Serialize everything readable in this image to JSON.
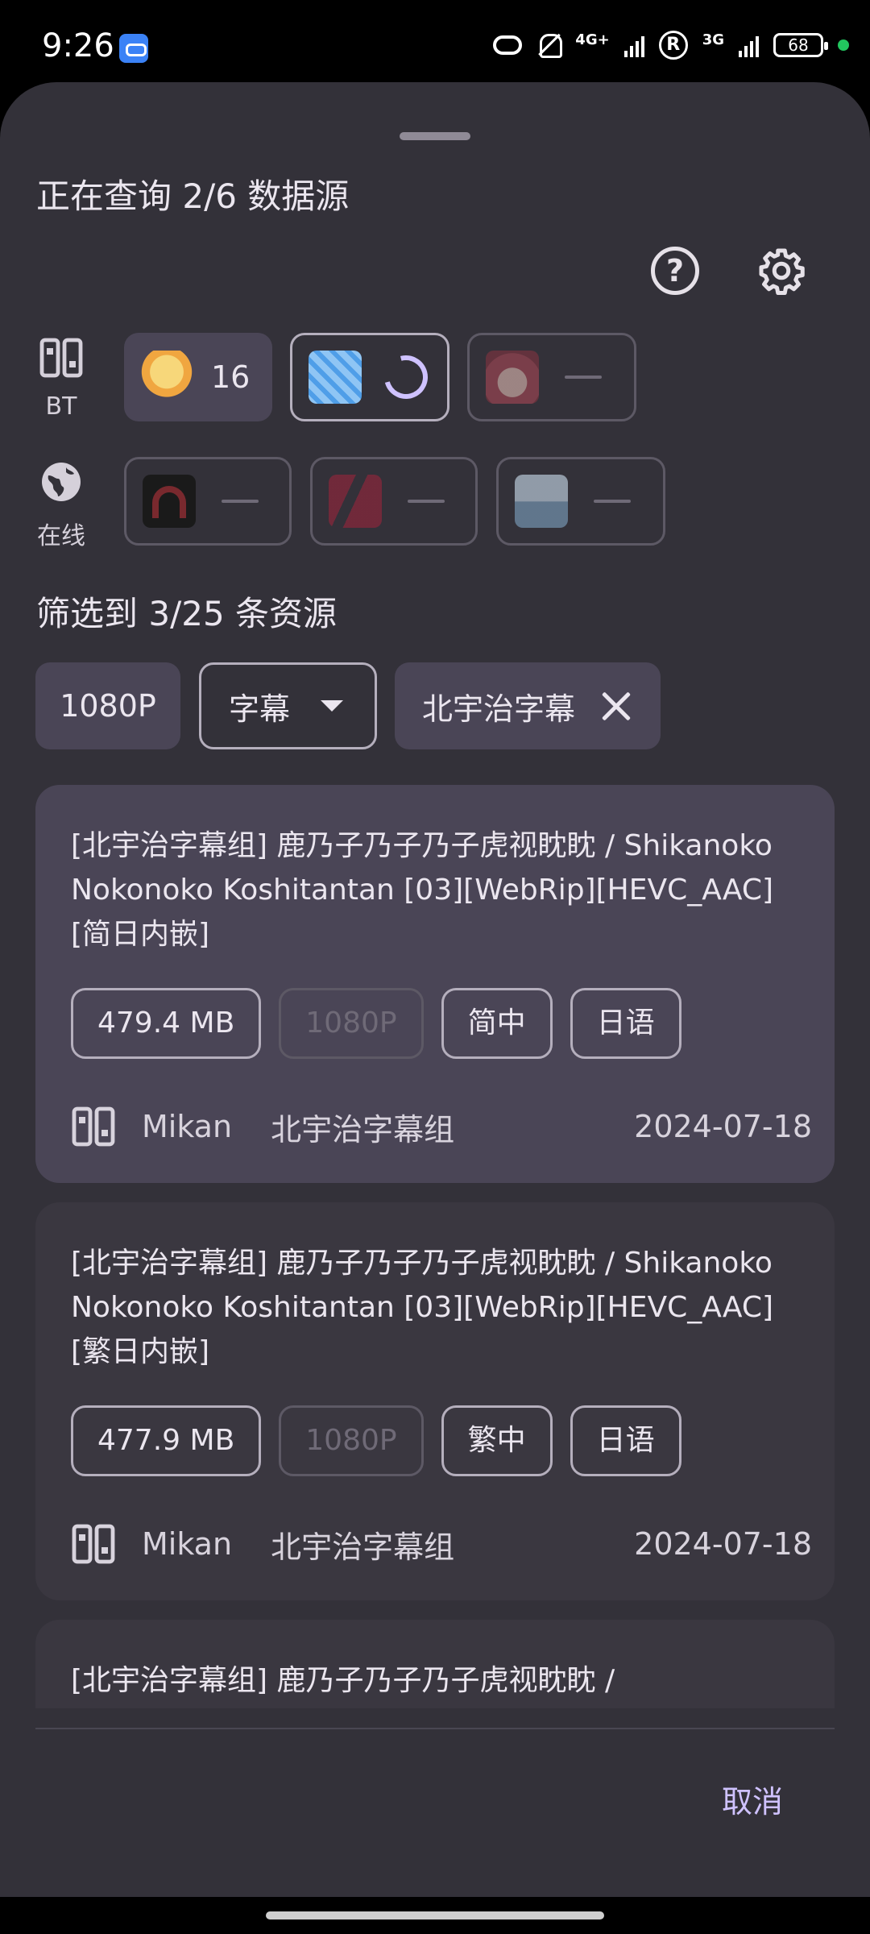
{
  "status_bar": {
    "time": "9:26",
    "network_4g": "4G+",
    "network_3g": "3G",
    "registered": "R",
    "battery": "68",
    "icons": [
      "link-app-icon",
      "hotspot-icon",
      "mute-icon",
      "signal-icon",
      "roaming-icon",
      "battery-icon"
    ]
  },
  "header": {
    "title": "正在查询 2/6 数据源",
    "help_icon": "question-circle",
    "settings_icon": "gear"
  },
  "sources": {
    "bt_label": "BT",
    "online_label": "在线",
    "bt": [
      {
        "state": "done",
        "count": "16"
      },
      {
        "state": "loading"
      },
      {
        "state": "empty"
      }
    ],
    "online": [
      {
        "state": "empty"
      },
      {
        "state": "empty"
      },
      {
        "state": "empty"
      }
    ]
  },
  "filter": {
    "title": "筛选到 3/25 条资源",
    "chips": {
      "resolution": "1080P",
      "subtitle": "字幕",
      "group": "北宇治字幕"
    }
  },
  "results": [
    {
      "title": "[北宇治字幕组] 鹿乃子乃子乃子虎视眈眈 / Shikanoko Nokonoko Koshitantan [03][WebRip][HEVC_AAC][简日内嵌]",
      "size": "479.4 MB",
      "resolution": "1080P",
      "subtitle_lang": "简中",
      "audio_lang": "日语",
      "source": "Mikan",
      "group": "北宇治字幕组",
      "date": "2024-07-18",
      "selected": true
    },
    {
      "title": "[北宇治字幕组] 鹿乃子乃子乃子虎视眈眈 / Shikanoko Nokonoko Koshitantan [03][WebRip][HEVC_AAC][繁日内嵌]",
      "size": "477.9 MB",
      "resolution": "1080P",
      "subtitle_lang": "繁中",
      "audio_lang": "日语",
      "source": "Mikan",
      "group": "北宇治字幕组",
      "date": "2024-07-18",
      "selected": false
    },
    {
      "title": "[北宇治字幕组] 鹿乃子乃子乃子虎视眈眈 /",
      "selected": false
    }
  ],
  "footer": {
    "cancel": "取消"
  },
  "colors": {
    "sheet_bg": "#333139",
    "card_bg": "#3a3740",
    "card_selected_bg": "#4a4556",
    "accent": "#cfc2ff"
  }
}
